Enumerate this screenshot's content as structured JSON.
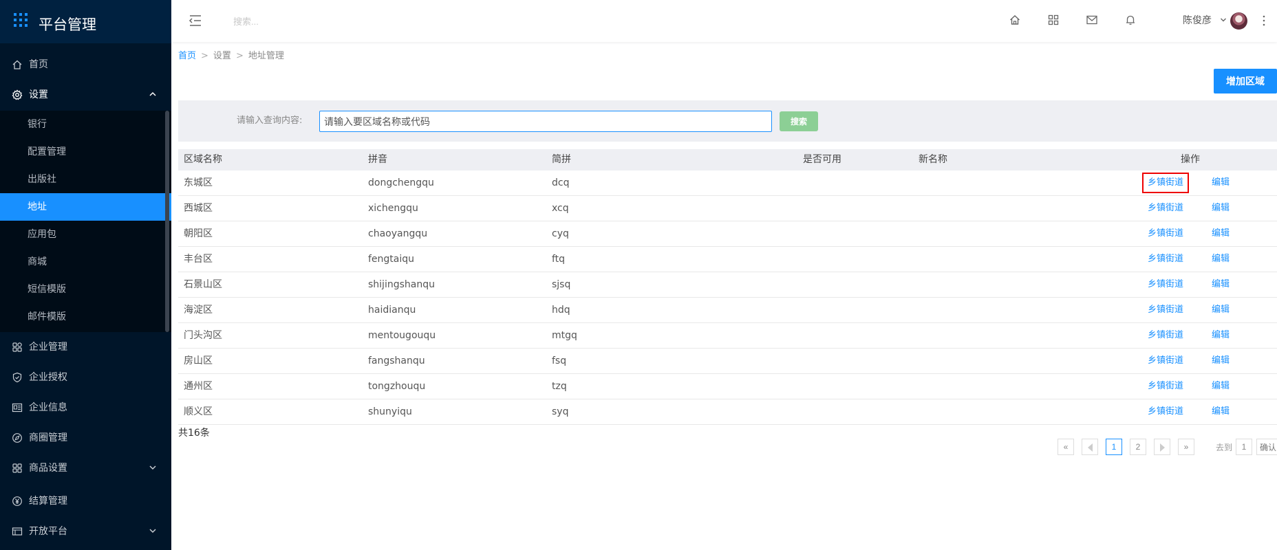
{
  "app": {
    "title": "平台管理"
  },
  "sidebar": {
    "items": [
      {
        "label": "首页",
        "icon": "home-icon"
      },
      {
        "label": "设置",
        "icon": "gear-icon",
        "expanded": true,
        "children": [
          {
            "label": "银行"
          },
          {
            "label": "配置管理"
          },
          {
            "label": "出版社"
          },
          {
            "label": "地址",
            "active": true
          },
          {
            "label": "应用包"
          },
          {
            "label": "商城"
          },
          {
            "label": "短信模版"
          },
          {
            "label": "邮件模版"
          }
        ]
      },
      {
        "label": "企业管理",
        "icon": "enterprise-icon"
      },
      {
        "label": "企业授权",
        "icon": "shield-check-icon"
      },
      {
        "label": "企业信息",
        "icon": "info-card-icon"
      },
      {
        "label": "商圈管理",
        "icon": "compass-icon"
      },
      {
        "label": "商品设置",
        "icon": "grid-icon",
        "has_children": true
      },
      {
        "label": "结算管理",
        "icon": "yuan-icon"
      },
      {
        "label": "开放平台",
        "icon": "platform-icon",
        "has_children": true
      }
    ]
  },
  "header": {
    "search_placeholder": "搜索...",
    "icons": [
      "home-icon",
      "apps-icon",
      "mail-icon",
      "bell-icon"
    ],
    "user_name": "陈俊彦"
  },
  "breadcrumb": {
    "home": "首页",
    "level2": "设置",
    "current": "地址管理",
    "separator": ">"
  },
  "actions": {
    "add_area": "增加区域"
  },
  "filter": {
    "label": "请输入查询内容:",
    "placeholder": "请输入要区域名称或代码",
    "button": "搜索"
  },
  "table": {
    "columns": [
      "区域名称",
      "拼音",
      "简拼",
      "是否可用",
      "新名称",
      "操作"
    ],
    "action_labels": {
      "streets": "乡镇街道",
      "edit": "编辑"
    },
    "rows": [
      {
        "name": "东城区",
        "pinyin": "dongchengqu",
        "abbr": "dcq",
        "enabled": "",
        "new_name": ""
      },
      {
        "name": "西城区",
        "pinyin": "xichengqu",
        "abbr": "xcq",
        "enabled": "",
        "new_name": ""
      },
      {
        "name": "朝阳区",
        "pinyin": "chaoyangqu",
        "abbr": "cyq",
        "enabled": "",
        "new_name": ""
      },
      {
        "name": "丰台区",
        "pinyin": "fengtaiqu",
        "abbr": "ftq",
        "enabled": "",
        "new_name": ""
      },
      {
        "name": "石景山区",
        "pinyin": "shijingshanqu",
        "abbr": "sjsq",
        "enabled": "",
        "new_name": ""
      },
      {
        "name": "海淀区",
        "pinyin": "haidianqu",
        "abbr": "hdq",
        "enabled": "",
        "new_name": ""
      },
      {
        "name": "门头沟区",
        "pinyin": "mentougouqu",
        "abbr": "mtgq",
        "enabled": "",
        "new_name": ""
      },
      {
        "name": "房山区",
        "pinyin": "fangshanqu",
        "abbr": "fsq",
        "enabled": "",
        "new_name": ""
      },
      {
        "name": "通州区",
        "pinyin": "tongzhouqu",
        "abbr": "tzq",
        "enabled": "",
        "new_name": ""
      },
      {
        "name": "顺义区",
        "pinyin": "shunyiqu",
        "abbr": "syq",
        "enabled": "",
        "new_name": ""
      }
    ]
  },
  "pagination": {
    "total_text": "共16条",
    "first": "«",
    "last": "»",
    "pages": [
      "1",
      "2"
    ],
    "current_page": 1,
    "goto_label": "去到",
    "goto_value": "1",
    "confirm": "确认"
  },
  "colors": {
    "sidebar_bg": "#001529",
    "primary": "#1890ff",
    "search_btn": "#8ccf95",
    "highlight": "#e00000"
  }
}
